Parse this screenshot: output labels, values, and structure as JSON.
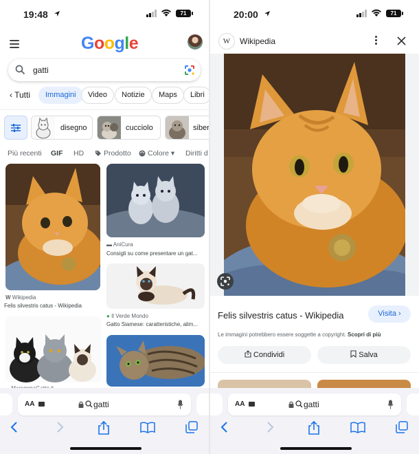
{
  "left": {
    "status": {
      "time": "19:48",
      "battery": "71"
    },
    "header": {
      "logo": "Google"
    },
    "search": {
      "query": "gatti"
    },
    "tabs": {
      "back": "Tutti",
      "items": [
        "Immagini",
        "Video",
        "Notizie",
        "Maps",
        "Libri"
      ],
      "active": "Immagini"
    },
    "filter_cards": [
      {
        "label": "disegno"
      },
      {
        "label": "cucciolo"
      },
      {
        "label": "siber"
      }
    ],
    "refine": [
      "Più recenti",
      "GIF",
      "HD",
      "Prodotto",
      "Colore",
      "Diritti d"
    ],
    "results": [
      {
        "source": "Wikipedia",
        "caption": "Felis silvestris catus - Wikipedia"
      },
      {
        "source": "AniCura",
        "caption": "Consigli su come presentare un gat..."
      },
      {
        "source": "Il Verde Mondo",
        "caption": "Gatto Siamese: caratteristiche, alim..."
      },
      {
        "source": "MaremmaGatto.it",
        "caption": ""
      }
    ],
    "safari": {
      "aa": "AA",
      "url": "gatti"
    }
  },
  "right": {
    "status": {
      "time": "20:00",
      "battery": "71"
    },
    "header": {
      "site_letter": "W",
      "title": "Wikipedia"
    },
    "caption": "Felis silvestris catus - Wikipedia",
    "visit_label": "Visita",
    "copyright": "Le immagini potrebbero essere soggette a copyright.",
    "copyright_link": "Scopri di più",
    "share_label": "Condividi",
    "save_label": "Salva",
    "safari": {
      "aa": "AA",
      "url": "gatti"
    }
  },
  "colors": {
    "accent": "#1967d2",
    "chip_active_bg": "#e8f0fe",
    "safari_bg": "#f2f2f7"
  },
  "icons": [
    "location-arrow-icon",
    "signal-icon",
    "wifi-icon",
    "battery-icon",
    "menu-icon",
    "avatar",
    "search-icon",
    "google-lens-icon",
    "chevron-left-icon",
    "sliders-icon",
    "tag-icon",
    "palette-icon",
    "more-vert-icon",
    "close-icon",
    "share-icon",
    "bookmark-icon",
    "lock-icon",
    "mic-icon",
    "tabs-icon",
    "book-icon",
    "chevron-right-icon"
  ]
}
